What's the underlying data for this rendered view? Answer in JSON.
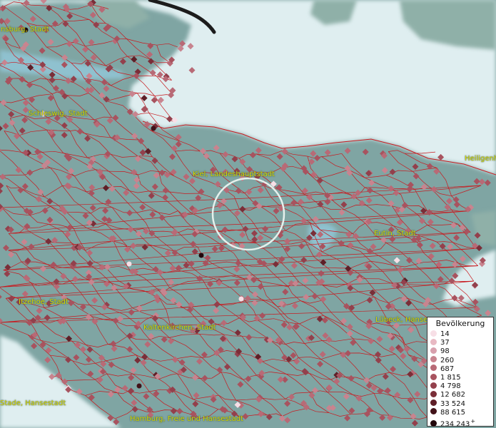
{
  "map": {
    "places": [
      {
        "id": "flensburg",
        "name": "nsburg, Stadt"
      },
      {
        "id": "schleswig",
        "name": "Schleswig, Stadt"
      },
      {
        "id": "kiel",
        "name": "Kiel, Landeshauptstadt"
      },
      {
        "id": "heiligenhafen",
        "name": "Heiligenh"
      },
      {
        "id": "eutin",
        "name": "Eutin, Stadt"
      },
      {
        "id": "itzehoe",
        "name": "Itzehoe, Stadt"
      },
      {
        "id": "kaltenkirchen",
        "name": "Kaltenkirchen, Stadt"
      },
      {
        "id": "luebeck",
        "name": "Lübeck, Hanse"
      },
      {
        "id": "stade",
        "name": "Stade, Hansestadt"
      },
      {
        "id": "hamburg",
        "name": "Hamburg, Freie und Hansestadt"
      }
    ],
    "colors": {
      "sea": "#dfeef0",
      "land": "#7fa5a3",
      "boundary": "#c8191e",
      "label": "#d8d800"
    }
  },
  "legend": {
    "title": "Bevölkerung",
    "plus": "+",
    "entries": [
      {
        "label": "14",
        "color": "#f7dfe6"
      },
      {
        "label": "37",
        "color": "#e8b9c3"
      },
      {
        "label": "98",
        "color": "#d8a0ad"
      },
      {
        "label": "260",
        "color": "#c8848f"
      },
      {
        "label": "687",
        "color": "#b86a76"
      },
      {
        "label": "1 815",
        "color": "#a8535f"
      },
      {
        "label": "4 798",
        "color": "#93404c"
      },
      {
        "label": "12 682",
        "color": "#7a2e38"
      },
      {
        "label": "33 524",
        "color": "#5e1f27"
      },
      {
        "label": "88 615",
        "color": "#411219"
      },
      {
        "label": "234 243",
        "color": "#22070b"
      }
    ]
  }
}
